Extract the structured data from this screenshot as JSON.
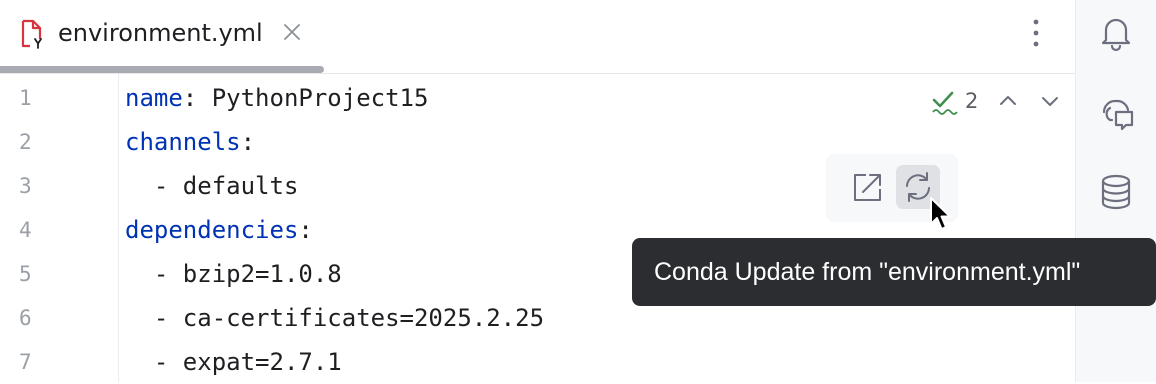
{
  "tab": {
    "filename": "environment.yml"
  },
  "inspection": {
    "count": "2"
  },
  "gutter": {
    "line_numbers": [
      "1",
      "2",
      "3",
      "4",
      "5",
      "6",
      "7"
    ]
  },
  "code": {
    "lines": [
      {
        "key": "name",
        "rest": ": PythonProject15"
      },
      {
        "key": "channels",
        "rest": ":"
      },
      {
        "key": "",
        "rest": "  - defaults"
      },
      {
        "key": "dependencies",
        "rest": ":"
      },
      {
        "key": "",
        "rest": "  - bzip2=1.0.8"
      },
      {
        "key": "",
        "rest": "  - ca-certificates=2025.2.25"
      },
      {
        "key": "",
        "rest": "  - expat=2.7.1"
      }
    ]
  },
  "tooltip": {
    "text": "Conda Update from \"environment.yml\""
  },
  "icons": {
    "tab_file": "yaml-file-icon",
    "tab_close": "close-icon",
    "more": "more-vertical-icon",
    "inspection_ok": "check-icon",
    "prev": "chevron-up-icon",
    "next": "chevron-down-icon",
    "open_external": "open-external-icon",
    "sync": "sync-icon",
    "notifications": "bell-icon",
    "ai_assistant": "ai-chat-icon",
    "database": "database-icon"
  },
  "colors": {
    "keyword": "#0033b3",
    "text": "#1e1f22",
    "line_numbers": "#9aa0a6",
    "tooltip_bg": "#2b2d30",
    "check": "#3f8f4f"
  }
}
